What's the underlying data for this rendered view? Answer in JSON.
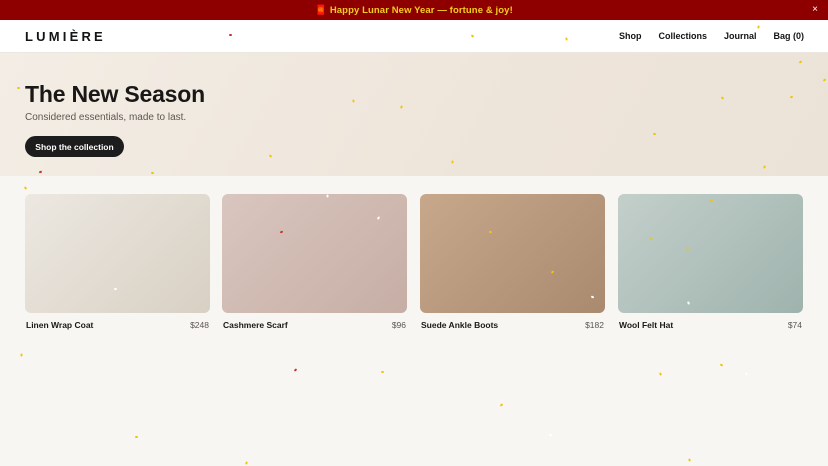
{
  "banner": {
    "icon": "red-envelope-icon",
    "text": "🧧 Happy Lunar New Year — fortune & joy!",
    "close_label": "×",
    "background": "#8e0000",
    "text_color": "#f5cd1f"
  },
  "header": {
    "logo": "LUMIÈRE",
    "nav": [
      {
        "label": "Shop"
      },
      {
        "label": "Collections"
      },
      {
        "label": "Journal"
      },
      {
        "label": "Bag (0)"
      }
    ]
  },
  "hero": {
    "title": "The New Season",
    "subtitle": "Considered essentials, made to last.",
    "cta_label": "Shop the collection"
  },
  "products": [
    {
      "name": "Linen Wrap Coat",
      "price": "$248",
      "image_colors": [
        "#ece8e1",
        "#d8d0c3"
      ]
    },
    {
      "name": "Cashmere Scarf",
      "price": "$96",
      "image_colors": [
        "#d9c6bf",
        "#c6aea5"
      ]
    },
    {
      "name": "Suede Ankle Boots",
      "price": "$182",
      "image_colors": [
        "#c8a88b",
        "#a98a6f"
      ]
    },
    {
      "name": "Wool Felt Hat",
      "price": "$74",
      "image_colors": [
        "#c3cfcb",
        "#9fb3ad"
      ]
    }
  ],
  "colors": {
    "confetti_gold": "#f1c40f",
    "confetti_red": "#c0392b",
    "confetti_white": "#ffffff"
  }
}
